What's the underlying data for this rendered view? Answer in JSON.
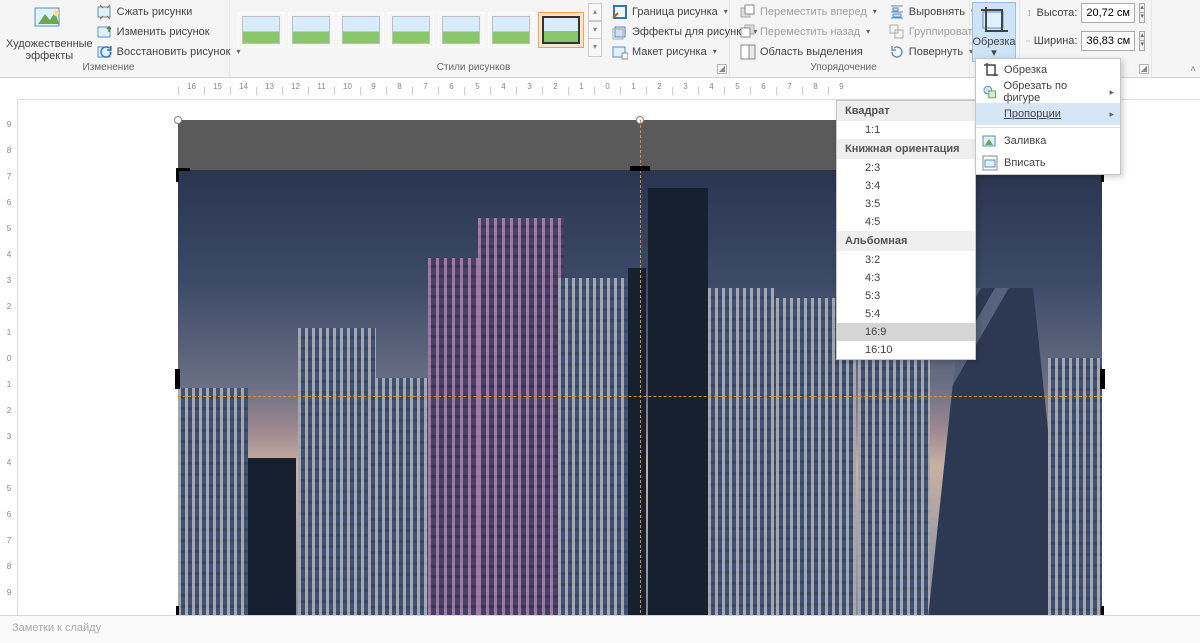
{
  "ribbon": {
    "groups": {
      "adjust": {
        "label": "Изменение",
        "artistic": "Художественные эффекты",
        "compress": "Сжать рисунки",
        "change": "Изменить рисунок",
        "reset": "Восстановить рисунок"
      },
      "styles": {
        "label": "Стили рисунков",
        "border": "Граница рисунка",
        "effects": "Эффекты для рисунка",
        "layout": "Макет рисунка"
      },
      "arrange": {
        "label": "Упорядочение",
        "forward": "Переместить вперед",
        "backward": "Переместить назад",
        "selpane": "Область выделения",
        "align": "Выровнять",
        "group": "Группировать",
        "rotate": "Повернуть"
      },
      "crop": {
        "button": "Обрезка"
      },
      "size": {
        "height_label": "Высота:",
        "width_label": "Ширина:",
        "height": "20,72 см",
        "width": "36,83 см"
      }
    }
  },
  "crop_menu": {
    "crop": "Обрезка",
    "crop_shape": "Обрезать по фигуре",
    "aspect": "Пропорции",
    "fill": "Заливка",
    "fit": "Вписать"
  },
  "aspect_menu": {
    "square_hdr": "Квадрат",
    "square": "1:1",
    "portrait_hdr": "Книжная ориентация",
    "portrait": [
      "2:3",
      "3:4",
      "3:5",
      "4:5"
    ],
    "landscape_hdr": "Альбомная",
    "landscape": [
      "3:2",
      "4:3",
      "5:3",
      "5:4",
      "16:9",
      "16:10"
    ],
    "highlighted": "16:9"
  },
  "hruler": [
    "16",
    "15",
    "14",
    "13",
    "12",
    "11",
    "10",
    "9",
    "8",
    "7",
    "6",
    "5",
    "4",
    "3",
    "2",
    "1",
    "0",
    "1",
    "2",
    "3",
    "4",
    "5",
    "6",
    "7",
    "8",
    "9"
  ],
  "vruler": [
    "9",
    "8",
    "7",
    "6",
    "5",
    "4",
    "3",
    "2",
    "1",
    "0",
    "1",
    "2",
    "3",
    "4",
    "5",
    "6",
    "7",
    "8",
    "9"
  ],
  "notes_placeholder": "Заметки к слайду"
}
